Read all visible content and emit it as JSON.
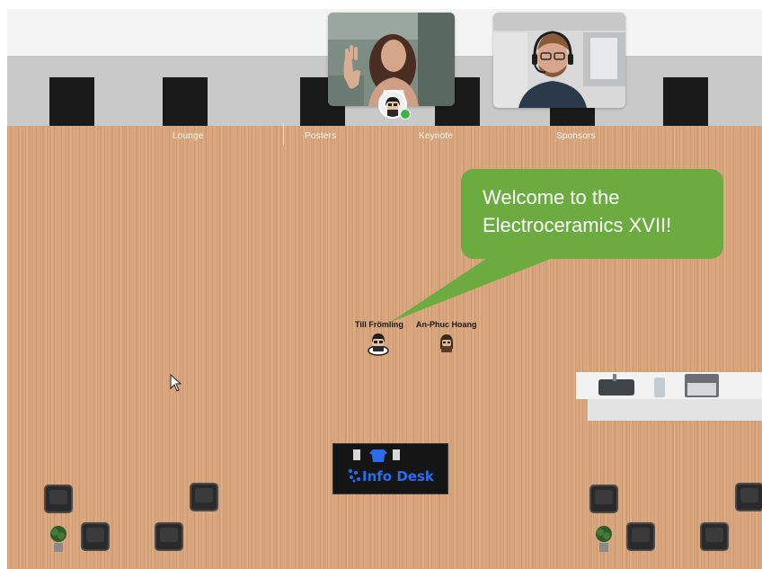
{
  "rooms": [
    {
      "label": "Lounge"
    },
    {
      "label": "Posters"
    },
    {
      "label": "Keynote"
    },
    {
      "label": "Sponsors"
    }
  ],
  "speech_bubble": {
    "line1": "Welcome to the",
    "line2": "Electroceramics XVII!"
  },
  "players": [
    {
      "name": "Till Frömling"
    },
    {
      "name": "An-Phuc Hoang"
    }
  ],
  "info_desk": {
    "label": "Info Desk"
  },
  "colors": {
    "floor": "#d8a57c",
    "bubble": "#6bab3f",
    "online_status": "#3ab54a",
    "info_desk_text": "#2a6cf0"
  },
  "icons": [
    "video-participant-1",
    "video-participant-2",
    "self-avatar-icon",
    "online-status-icon",
    "info-desk-icon",
    "plant-icon",
    "chair-icon",
    "mouse-cursor-icon"
  ]
}
